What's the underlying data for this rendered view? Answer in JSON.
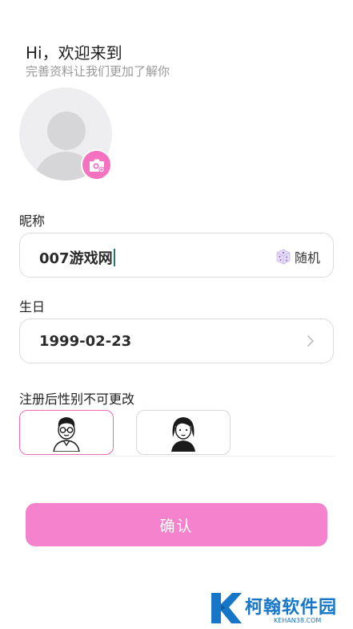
{
  "header": {
    "greeting": "Hi，欢迎来到",
    "subtitle": "完善资料让我们更加了解你"
  },
  "avatar": {
    "icon": "default-avatar-icon",
    "camera_icon": "camera-add-icon",
    "accent_color": "#f472c0"
  },
  "nickname": {
    "label": "昵称",
    "value": "007游戏网",
    "random_label": "随机",
    "random_icon": "dice-icon"
  },
  "birthday": {
    "label": "生日",
    "value": "1999-02-23",
    "chevron_icon": "chevron-right-icon"
  },
  "gender": {
    "label": "注册后性别不可更改",
    "options": [
      {
        "name": "male",
        "icon": "male-avatar-icon",
        "selected": true
      },
      {
        "name": "female",
        "icon": "female-avatar-icon",
        "selected": false
      }
    ],
    "selected_color": "#f06ab8"
  },
  "confirm": {
    "label": "确认",
    "color": "#f582cc"
  },
  "watermark": {
    "name": "柯翰软件园",
    "url": "KEHAN38.COM"
  }
}
